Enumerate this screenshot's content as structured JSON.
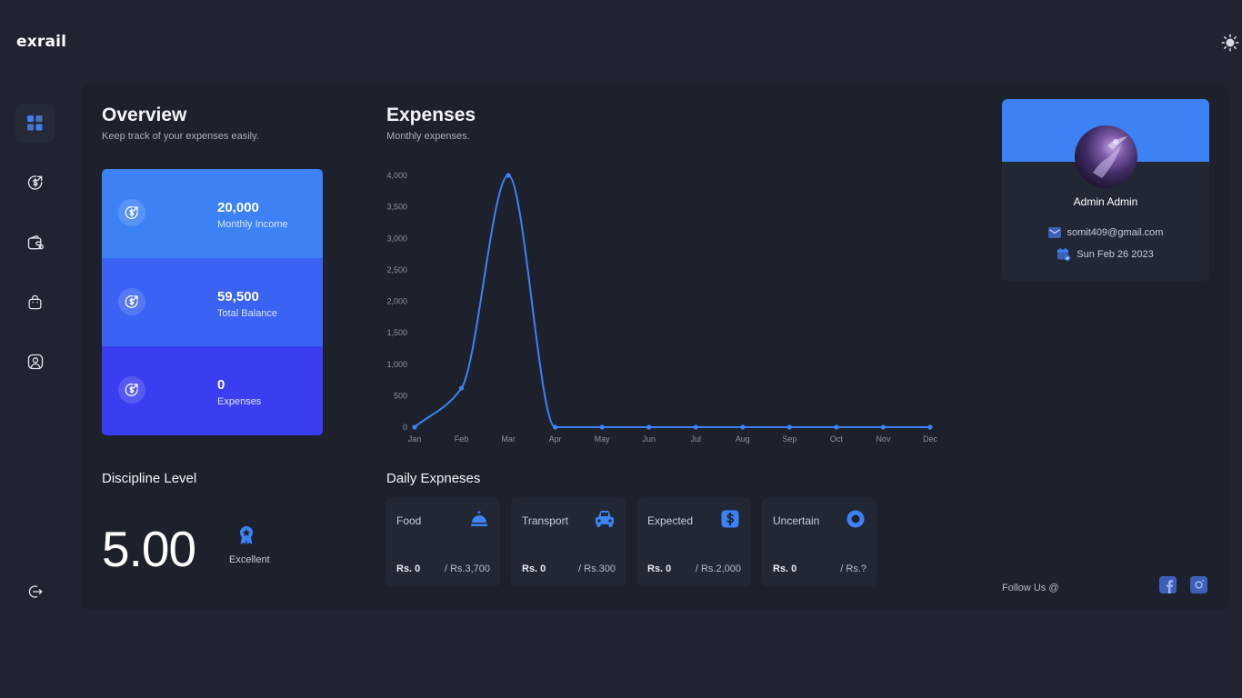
{
  "app": {
    "logo": "exrail"
  },
  "theme": {
    "icon": "sun-icon"
  },
  "sidebar": {
    "items": [
      {
        "name": "dashboard",
        "icon": "grid-icon",
        "active": true
      },
      {
        "name": "income",
        "icon": "dollar-circle-icon",
        "active": false
      },
      {
        "name": "wallet",
        "icon": "wallet-icon",
        "active": false
      },
      {
        "name": "shopping",
        "icon": "bag-icon",
        "active": false
      },
      {
        "name": "profile",
        "icon": "user-icon",
        "active": false
      }
    ],
    "logout_icon": "logout-icon"
  },
  "overview": {
    "title": "Overview",
    "subtitle": "Keep track of your expenses easily.",
    "stats": [
      {
        "value": "20,000",
        "label": "Monthly Income",
        "color": "#3d82f4"
      },
      {
        "value": "59,500",
        "label": "Total Balance",
        "color": "#3a62f3"
      },
      {
        "value": "0",
        "label": "Expenses",
        "color": "#3b3ef0"
      }
    ]
  },
  "expenses": {
    "title": "Expenses",
    "subtitle": "Monthly expenses."
  },
  "chart_data": {
    "type": "line",
    "x": [
      "Jan",
      "Feb",
      "Mar",
      "Apr",
      "May",
      "Jun",
      "Jul",
      "Aug",
      "Sep",
      "Oct",
      "Nov",
      "Dec"
    ],
    "series": [
      {
        "values": [
          0,
          620,
          4000,
          0,
          0,
          0,
          0,
          0,
          0,
          0,
          0,
          0
        ],
        "color": "#3d82f4"
      }
    ],
    "y_ticks": [
      "0",
      "500",
      "1,000",
      "1,500",
      "2,000",
      "2,500",
      "3,000",
      "3,500",
      "4,000"
    ],
    "ylim": [
      0,
      4000
    ],
    "grid": false
  },
  "discipline": {
    "title": "Discipline Level",
    "value": "5.00",
    "badge": "Excellent",
    "badge_icon": "award-icon"
  },
  "daily": {
    "title": "Daily Expneses",
    "cards": [
      {
        "name": "Food",
        "icon": "food-cloche-icon",
        "spent": "Rs. 0",
        "budget": "/ Rs.3,700"
      },
      {
        "name": "Transport",
        "icon": "car-icon",
        "spent": "Rs. 0",
        "budget": "/ Rs.300"
      },
      {
        "name": "Expected",
        "icon": "dollar-square-icon",
        "spent": "Rs. 0",
        "budget": "/ Rs.2,000"
      },
      {
        "name": "Uncertain",
        "icon": "record-circle-icon",
        "spent": "Rs. 0",
        "budget": "/ Rs.?"
      }
    ]
  },
  "profile": {
    "name": "Admin Admin",
    "email": "somit409@gmail.com",
    "date": "Sun Feb 26 2023",
    "email_icon": "mail-icon",
    "date_icon": "calendar-icon"
  },
  "footer": {
    "follow": "Follow Us @",
    "socials": [
      "facebook-icon",
      "instagram-icon"
    ]
  },
  "colors": {
    "accent": "#3d82f4",
    "background": "#1f2430",
    "panel": "#1c212c",
    "card": "#222734"
  }
}
